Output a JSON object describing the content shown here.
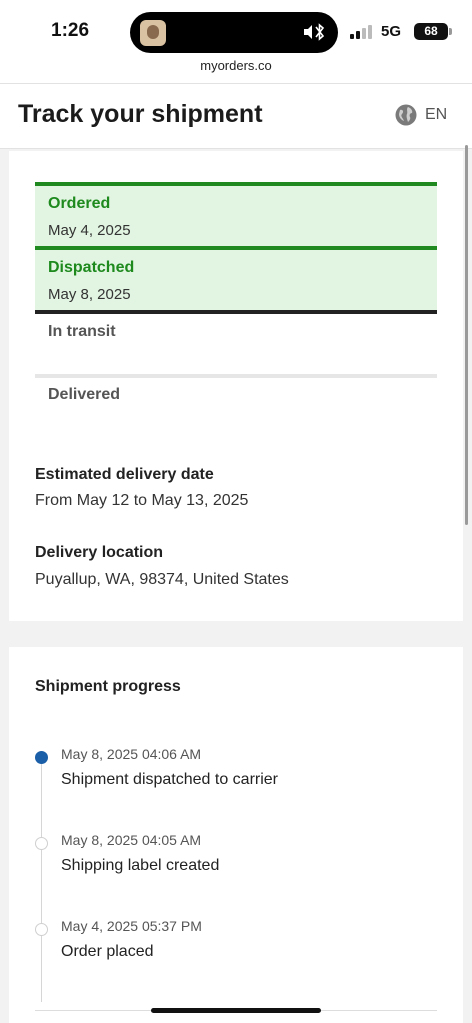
{
  "status_bar": {
    "time": "1:26",
    "network": "5G",
    "battery": "68"
  },
  "browser": {
    "url": "myorders.co"
  },
  "header": {
    "title": "Track your shipment",
    "language": "EN"
  },
  "steps": [
    {
      "name": "Ordered",
      "date": "May 4, 2025",
      "state": "done"
    },
    {
      "name": "Dispatched",
      "date": "May 8, 2025",
      "state": "done"
    },
    {
      "name": "In transit",
      "date": "",
      "state": "current"
    },
    {
      "name": "Delivered",
      "date": "",
      "state": "pending"
    }
  ],
  "delivery": {
    "estimated_label": "Estimated delivery date",
    "estimated_value": "From May 12 to May 13, 2025",
    "location_label": "Delivery location",
    "location_value": "Puyallup, WA, 98374, United States"
  },
  "progress": {
    "title": "Shipment progress",
    "events": [
      {
        "time": "May 8, 2025 04:06 AM",
        "text": "Shipment dispatched to carrier",
        "active": true
      },
      {
        "time": "May 8, 2025 04:05 AM",
        "text": "Shipping label created",
        "active": false
      },
      {
        "time": "May 4, 2025 05:37 PM",
        "text": "Order placed",
        "active": false
      }
    ]
  },
  "colors": {
    "done_green": "#1e8a1e",
    "done_bg": "#e2f5e2",
    "active_dot": "#1b5fa8"
  }
}
